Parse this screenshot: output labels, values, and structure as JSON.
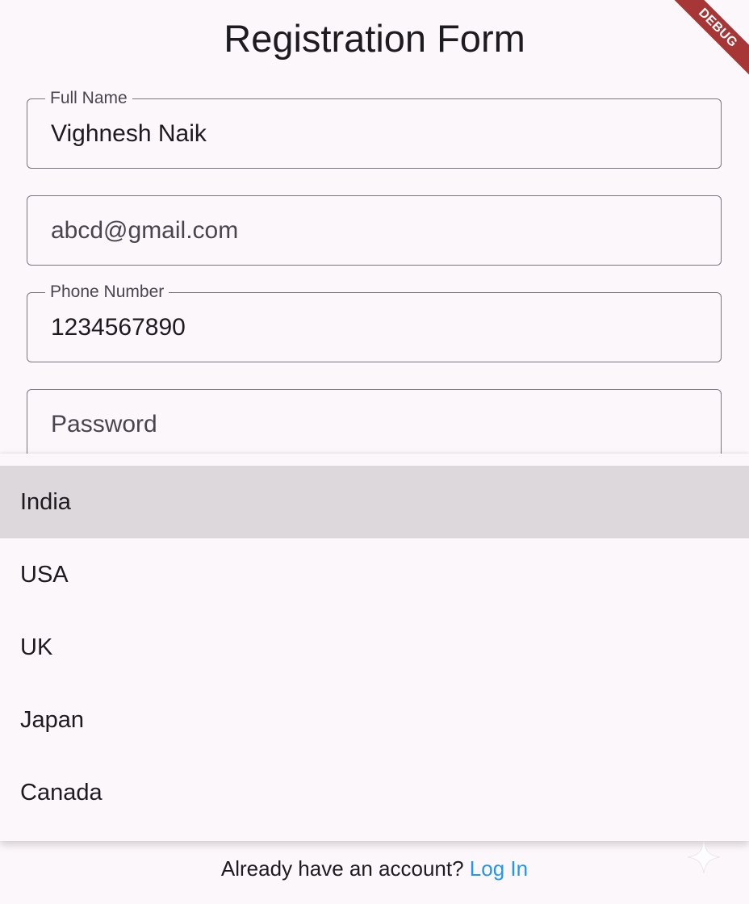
{
  "page": {
    "title": "Registration Form"
  },
  "form": {
    "full_name": {
      "label": "Full Name",
      "value": "Vighnesh Naik"
    },
    "email": {
      "value": "abcd@gmail.com"
    },
    "phone": {
      "label": "Phone Number",
      "value": "1234567890"
    },
    "password": {
      "placeholder": "Password"
    }
  },
  "dropdown": {
    "options": [
      {
        "label": "India",
        "selected": true
      },
      {
        "label": "USA",
        "selected": false
      },
      {
        "label": "UK",
        "selected": false
      },
      {
        "label": "Japan",
        "selected": false
      },
      {
        "label": "Canada",
        "selected": false
      }
    ]
  },
  "footer": {
    "prompt": "Already have an account?",
    "link": "Log In"
  },
  "debug_banner": {
    "label": "DEBUG"
  },
  "icons": {
    "corner_icon": "sparkle-icon"
  },
  "colors": {
    "background": "#fcf7fb",
    "link": "#2196f3",
    "selected_item": "#dcd8dc",
    "border": "#79747e",
    "debug": "#a73737"
  }
}
